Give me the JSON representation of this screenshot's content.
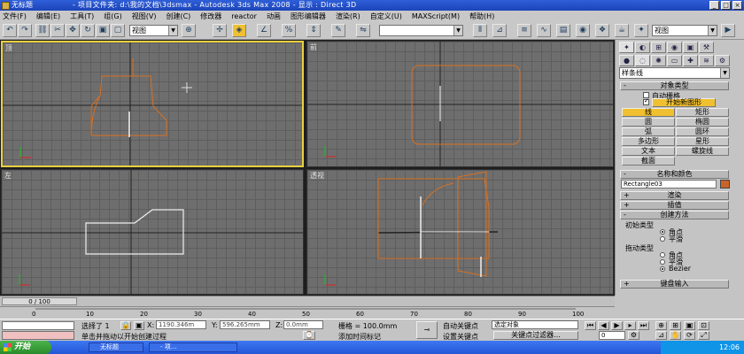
{
  "title_bar": {
    "doc_name": "无标题",
    "title": "- 项目文件夹: d:\\我的文档\\3dsmax    - Autodesk 3ds Max 2008    - 显示 : Direct 3D",
    "buttons": [
      "_",
      "□",
      "×"
    ]
  },
  "menu": [
    "文件(F)",
    "编辑(E)",
    "工具(T)",
    "组(G)",
    "视图(V)",
    "创建(C)",
    "修改器",
    "reactor",
    "动画",
    "图形编辑器",
    "渲染(R)",
    "自定义(U)",
    "MAXScript(M)",
    "帮助(H)"
  ],
  "toolbar": {
    "coord_system": "视图",
    "selection_set": "",
    "named_view": "视图"
  },
  "viewports": {
    "top": "顶",
    "front": "前",
    "left": "左",
    "perspective": "透视"
  },
  "command_panel": {
    "category": "样条线",
    "rollout_object_type": "对象类型",
    "auto_grid": "自动栅格",
    "start_new_shape": "开始新图形",
    "shape_buttons": [
      [
        "线",
        "矩形"
      ],
      [
        "圆",
        "椭圆"
      ],
      [
        "弧",
        "圆环"
      ],
      [
        "多边形",
        "星形"
      ],
      [
        "文本",
        "螺旋线"
      ],
      [
        "截面",
        ""
      ]
    ],
    "rollout_name_color": "名称和颜色",
    "object_name": "Rectangle03",
    "object_color": "#c86428",
    "rollout_render": "渲染",
    "rollout_interp": "插值",
    "rollout_create_method": "创建方法",
    "initial_type_label": "初始类型",
    "initial_options": [
      "角点",
      "平滑"
    ],
    "drag_type_label": "拖动类型",
    "drag_options": [
      "角点",
      "平滑",
      "Bezier"
    ],
    "rollout_keyboard": "键盘输入"
  },
  "time_slider": {
    "frame_text": "0 / 100"
  },
  "track_ticks": [
    "0",
    "10",
    "20",
    "30",
    "40",
    "50",
    "60",
    "70",
    "80",
    "90",
    "100"
  ],
  "status": {
    "selected": "选择了 1",
    "x_label": "X:",
    "x_value": "1190.346m",
    "y_label": "Y:",
    "y_value": "596.265mm",
    "z_label": "Z:",
    "z_value": "0.0mm",
    "grid": "栅格 = 100.0mm",
    "auto_key": "自动关键点",
    "selected_object": "选定对象",
    "set_key": "设置关键点",
    "key_filters": "关键点过滤器...",
    "prompt": "单击并拖动以开始创建过程",
    "add_time_tag": "添加时间标记",
    "frame_field": "0"
  },
  "taskbar": {
    "start": "开始",
    "items": [
      "无标题",
      "- 项..."
    ],
    "clock": "12:06"
  }
}
